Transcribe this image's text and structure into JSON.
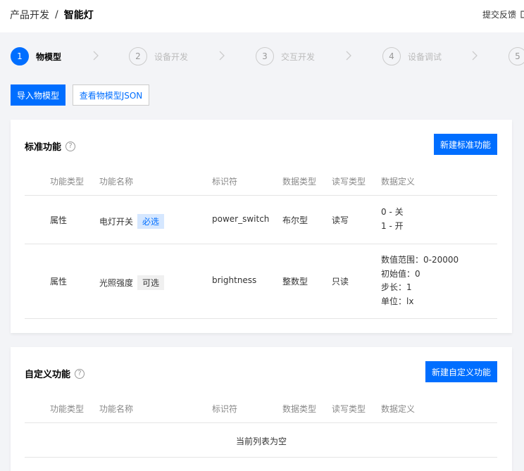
{
  "breadcrumb": {
    "parent": "产品开发",
    "separator": "/",
    "current": "智能灯"
  },
  "feedback_label": "提交反馈",
  "steps": [
    {
      "num": "1",
      "label": "物模型",
      "active": true
    },
    {
      "num": "2",
      "label": "设备开发"
    },
    {
      "num": "3",
      "label": "交互开发"
    },
    {
      "num": "4",
      "label": "设备调试"
    },
    {
      "num": "5",
      "label": ""
    }
  ],
  "toolbar": {
    "import_label": "导入物模型",
    "view_json_label": "查看物模型JSON"
  },
  "columns": [
    "功能类型",
    "功能名称",
    "标识符",
    "数据类型",
    "读写类型",
    "数据定义"
  ],
  "standard": {
    "title": "标准功能",
    "help_glyph": "?",
    "create_label": "新建标准功能",
    "rows": [
      {
        "type": "属性",
        "name": "电灯开关",
        "tag": "必选",
        "id": "power_switch",
        "data_type": "布尔型",
        "rw": "读写",
        "def": [
          "0 - 关",
          "1 - 开"
        ]
      },
      {
        "type": "属性",
        "name": "光照强度",
        "tag": "可选",
        "id": "brightness",
        "data_type": "整数型",
        "rw": "只读",
        "def": [
          "数值范围：0-20000",
          "初始值：0",
          "步长：1",
          "单位：lx"
        ]
      }
    ]
  },
  "custom": {
    "title": "自定义功能",
    "help_glyph": "?",
    "create_label": "新建自定义功能",
    "empty_text": "当前列表为空"
  },
  "colors": {
    "accent": "#006eff",
    "tag_required_bg": "#d5e7ff"
  }
}
